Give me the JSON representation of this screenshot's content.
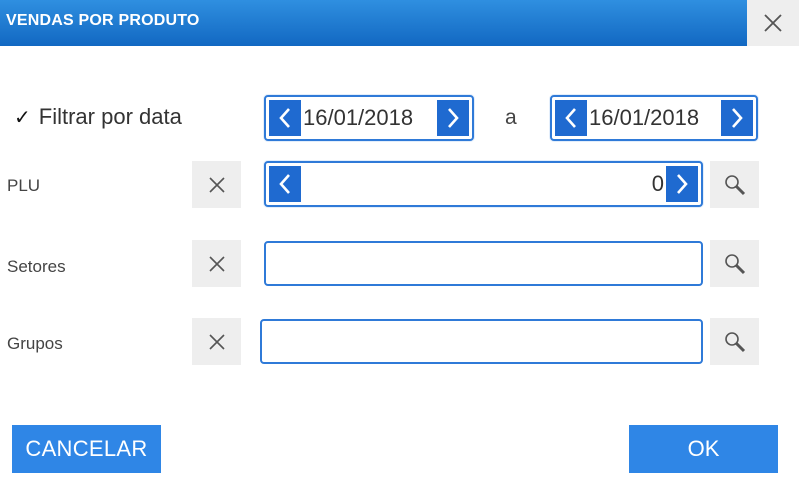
{
  "window": {
    "title": "VENDAS POR PRODUTO",
    "close_icon": "close-icon"
  },
  "date_filter": {
    "label": "Filtrar por data",
    "checked": true,
    "check_glyph": "✓",
    "from_date": "16/01/2018",
    "separator": "a",
    "to_date": "16/01/2018"
  },
  "plu": {
    "label": "PLU",
    "value": "0"
  },
  "setores": {
    "label": "Setores",
    "value": ""
  },
  "grupos": {
    "label": "Grupos",
    "value": ""
  },
  "buttons": {
    "cancel": "CANCELAR",
    "ok": "OK"
  },
  "colors": {
    "accent": "#2f86e6",
    "spinner_button": "#1f6ad0",
    "field_border": "#2f7ad8",
    "button_gray": "#eeeeee"
  }
}
